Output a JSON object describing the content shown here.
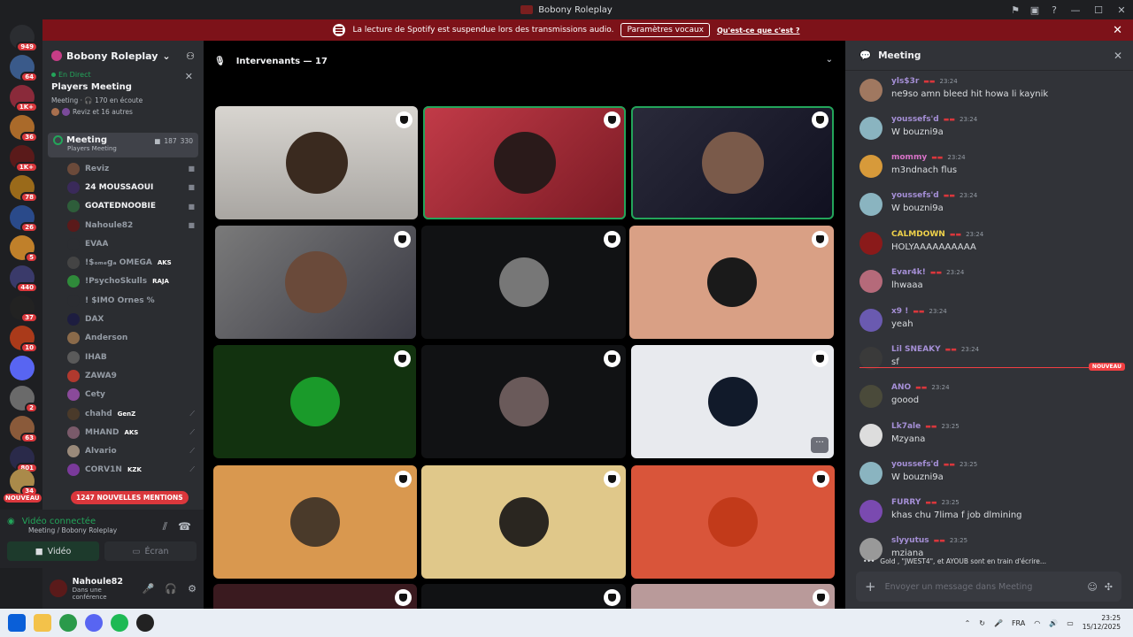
{
  "window": {
    "title": "Bobony Roleplay",
    "controls": [
      "—",
      "☐",
      "✕"
    ]
  },
  "banner": {
    "message": "La lecture de Spotify est suspendue lors des transmissions audio.",
    "button": "Paramètres vocaux",
    "link": "Qu'est-ce que c'est ?"
  },
  "guilds": {
    "badges": [
      "949",
      "64",
      "1K+",
      "36",
      "1K+",
      "78",
      "26",
      "5",
      "440",
      "37",
      "10",
      "2",
      "63",
      "801",
      "34"
    ],
    "nouveau": "NOUVEAU"
  },
  "server": {
    "name": "Bobony Roleplay"
  },
  "event": {
    "live": "En Direct",
    "title": "Players Meeting",
    "meta_channel": "Meeting",
    "meta_listening": "170 en écoute",
    "meta_others": "Reviz et 16 autres"
  },
  "voice_channel": {
    "name": "Meeting",
    "sub": "Players Meeting",
    "count1": "187",
    "count2": "330"
  },
  "members": [
    {
      "name": "Reviz",
      "tag": "",
      "color": "#949ba4",
      "av": "#6b4a3a"
    },
    {
      "name": "24 MOUSSAOUI",
      "tag": "",
      "color": "#f2f3f5",
      "av": "#3a2a5a"
    },
    {
      "name": "GOATEDNOOBIE",
      "tag": "",
      "color": "#f2f3f5",
      "av": "#2e5d3a"
    },
    {
      "name": "Nahoule82",
      "tag": "",
      "color": "#949ba4",
      "av": "#5a1a1a"
    },
    {
      "name": "EVAA",
      "tag": "",
      "color": "#949ba4",
      "av": "#2b2d31"
    },
    {
      "name": "!$ₒₘₑgₐ OMEGA",
      "tag": "AKS",
      "color": "#949ba4",
      "av": "#444"
    },
    {
      "name": "!PsychoSkulls",
      "tag": "RAJA",
      "color": "#949ba4",
      "av": "#2f8a3a"
    },
    {
      "name": "! $IMO Ornes %",
      "tag": "",
      "color": "#949ba4",
      "av": "#2b2d31"
    },
    {
      "name": "DAX",
      "tag": "",
      "color": "#949ba4",
      "av": "#1d1d40"
    },
    {
      "name": "Anderson",
      "tag": "",
      "color": "#949ba4",
      "av": "#8a6a4a"
    },
    {
      "name": "IHAB",
      "tag": "",
      "color": "#949ba4",
      "av": "#5a5a5a"
    },
    {
      "name": "ZAWA9",
      "tag": "",
      "color": "#949ba4",
      "av": "#b0392e"
    },
    {
      "name": "Cety",
      "tag": "",
      "color": "#949ba4",
      "av": "#8a4a9a"
    },
    {
      "name": "chahd",
      "tag": "GenZ",
      "color": "#949ba4",
      "av": "#4a3a2a"
    },
    {
      "name": "MHAND",
      "tag": "AKS",
      "color": "#949ba4",
      "av": "#7a5a6a"
    },
    {
      "name": "Alvario",
      "tag": "",
      "color": "#949ba4",
      "av": "#9a8a7a"
    },
    {
      "name": "CORV1N",
      "tag": "KZK",
      "color": "#949ba4",
      "av": "#7a3a9a"
    }
  ],
  "mentions": "1247 NOUVELLES MENTIONS",
  "voice_panel": {
    "status": "Vidéo connectée",
    "sub": "Meeting",
    "server": "/ Bobony Roleplay",
    "video": "Vidéo",
    "screen": "Écran"
  },
  "user": {
    "name": "Nahoule82",
    "status": "Dans une conférence"
  },
  "stage": {
    "header": "Intervenants — 17"
  },
  "chat": {
    "title": "Meeting",
    "new_label": "NOUVEAU",
    "messages": [
      {
        "name": "yls$3r",
        "time": "23:24",
        "text": "ne9so amn bleed hit howa li kaynik",
        "color": "#a58fd6",
        "av": "#a07860"
      },
      {
        "name": "youssefs'd",
        "time": "23:24",
        "text": "W bouzni9a",
        "color": "#a58fd6",
        "av": "#8ab4c0"
      },
      {
        "name": "mommy",
        "time": "23:24",
        "text": "m3ndnach flus",
        "color": "#d873c8",
        "av": "#d79a3a"
      },
      {
        "name": "youssefs'd",
        "time": "23:24",
        "text": "W bouzni9a",
        "color": "#a58fd6",
        "av": "#8ab4c0"
      },
      {
        "name": "CALMDOWN",
        "time": "23:24",
        "text": "HOLYAAAAAAAAAA",
        "color": "#f0d24a",
        "av": "#8a1a1a"
      },
      {
        "name": "Evar4k!",
        "time": "23:24",
        "text": "lhwaaa",
        "color": "#a58fd6",
        "av": "#b56a7a"
      },
      {
        "name": "x9 !",
        "time": "23:24",
        "text": "yeah",
        "color": "#a58fd6",
        "av": "#6a5ab0"
      },
      {
        "name": "Lil SNEAKY",
        "time": "23:24",
        "text": "sf",
        "color": "#a58fd6",
        "av": "#3a3a3a"
      },
      {
        "name": "ANO",
        "time": "23:24",
        "text": "goood",
        "color": "#a58fd6",
        "av": "#4a4a3a"
      },
      {
        "name": "Lk7ale",
        "time": "23:25",
        "text": "Mzyana",
        "color": "#a58fd6",
        "av": "#ddd"
      },
      {
        "name": "youssefs'd",
        "time": "23:25",
        "text": "W bouzni9a",
        "color": "#a58fd6",
        "av": "#8ab4c0"
      },
      {
        "name": "FURRY",
        "time": "23:25",
        "text": "khas chu 7lima f job dlmining",
        "color": "#a58fd6",
        "av": "#7a4ab0"
      },
      {
        "name": "slyyutus",
        "time": "23:25",
        "text": "mziana",
        "color": "#a58fd6",
        "av": "#999"
      }
    ],
    "typing": "Gold , \"JWEST4\", et AYOUB sont en train d'écrire...",
    "placeholder": "Envoyer un message dans Meeting"
  },
  "taskbar": {
    "lang": "FRA",
    "time": "23:25",
    "date": "15/12/2025"
  }
}
